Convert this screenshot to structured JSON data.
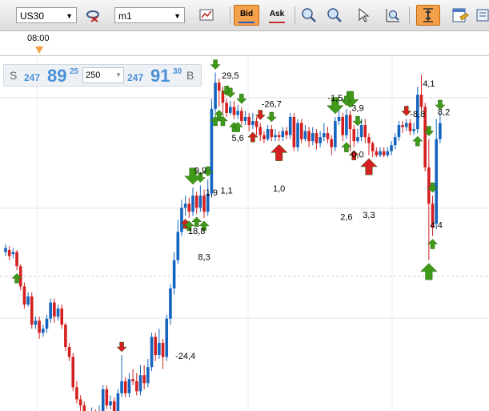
{
  "toolbar": {
    "symbol": "US30",
    "timeframe": "m1",
    "bid_label": "Bid",
    "ask_label": "Ask"
  },
  "time_axis": {
    "label": "08:00"
  },
  "quote": {
    "sell_label": "S",
    "sell_prefix": "247",
    "sell_main": "89",
    "sell_sup": "25",
    "amount": "250",
    "buy_prefix": "247",
    "buy_main": "91",
    "buy_sup": "30",
    "buy_label": "B"
  },
  "colors": {
    "bull": "#1565c0",
    "bear": "#d42020",
    "arrow_green": "#3f9a1a",
    "arrow_red": "#d42020",
    "accent": "#f5a04a"
  },
  "chart_data": {
    "type": "candlestick",
    "candles": [
      {
        "o": 356,
        "c": 358,
        "h": 360,
        "l": 354
      },
      {
        "o": 357,
        "c": 354,
        "h": 359,
        "l": 352
      },
      {
        "o": 355,
        "c": 356,
        "h": 358,
        "l": 353
      },
      {
        "o": 356,
        "c": 349,
        "h": 357,
        "l": 347
      },
      {
        "o": 349,
        "c": 339,
        "h": 350,
        "l": 337
      },
      {
        "o": 339,
        "c": 330,
        "h": 341,
        "l": 328
      },
      {
        "o": 330,
        "c": 334,
        "h": 336,
        "l": 329
      },
      {
        "o": 334,
        "c": 320,
        "h": 336,
        "l": 318
      },
      {
        "o": 320,
        "c": 322,
        "h": 324,
        "l": 318
      },
      {
        "o": 322,
        "c": 316,
        "h": 324,
        "l": 313
      },
      {
        "o": 316,
        "c": 318,
        "h": 320,
        "l": 314
      },
      {
        "o": 318,
        "c": 323,
        "h": 325,
        "l": 316
      },
      {
        "o": 323,
        "c": 331,
        "h": 333,
        "l": 321
      },
      {
        "o": 331,
        "c": 324,
        "h": 333,
        "l": 321
      },
      {
        "o": 324,
        "c": 328,
        "h": 330,
        "l": 322
      },
      {
        "o": 328,
        "c": 320,
        "h": 330,
        "l": 318
      },
      {
        "o": 320,
        "c": 309,
        "h": 321,
        "l": 307
      },
      {
        "o": 309,
        "c": 304,
        "h": 311,
        "l": 302
      },
      {
        "o": 304,
        "c": 289,
        "h": 306,
        "l": 287
      },
      {
        "o": 289,
        "c": 283,
        "h": 292,
        "l": 281
      },
      {
        "o": 283,
        "c": 280,
        "h": 285,
        "l": 276
      },
      {
        "o": 280,
        "c": 274,
        "h": 282,
        "l": 272
      },
      {
        "o": 274,
        "c": 270,
        "h": 276,
        "l": 268
      },
      {
        "o": 270,
        "c": 276,
        "h": 279,
        "l": 268
      },
      {
        "o": 276,
        "c": 271,
        "h": 278,
        "l": 268
      },
      {
        "o": 271,
        "c": 276,
        "h": 280,
        "l": 269
      },
      {
        "o": 276,
        "c": 288,
        "h": 290,
        "l": 274
      },
      {
        "o": 288,
        "c": 280,
        "h": 290,
        "l": 278
      },
      {
        "o": 280,
        "c": 282,
        "h": 285,
        "l": 278
      },
      {
        "o": 282,
        "c": 273,
        "h": 284,
        "l": 271
      },
      {
        "o": 273,
        "c": 286,
        "h": 288,
        "l": 271
      },
      {
        "o": 286,
        "c": 292,
        "h": 305,
        "l": 284
      },
      {
        "o": 292,
        "c": 286,
        "h": 294,
        "l": 284
      },
      {
        "o": 286,
        "c": 293,
        "h": 296,
        "l": 284
      },
      {
        "o": 293,
        "c": 292,
        "h": 298,
        "l": 290
      },
      {
        "o": 292,
        "c": 287,
        "h": 296,
        "l": 285
      },
      {
        "o": 287,
        "c": 295,
        "h": 300,
        "l": 285
      },
      {
        "o": 295,
        "c": 291,
        "h": 300,
        "l": 288
      },
      {
        "o": 291,
        "c": 299,
        "h": 303,
        "l": 289
      },
      {
        "o": 299,
        "c": 314,
        "h": 316,
        "l": 297
      },
      {
        "o": 314,
        "c": 305,
        "h": 316,
        "l": 302
      },
      {
        "o": 305,
        "c": 311,
        "h": 318,
        "l": 303
      },
      {
        "o": 311,
        "c": 304,
        "h": 313,
        "l": 298
      },
      {
        "o": 304,
        "c": 323,
        "h": 325,
        "l": 302
      },
      {
        "o": 323,
        "c": 338,
        "h": 340,
        "l": 320
      },
      {
        "o": 338,
        "c": 352,
        "h": 356,
        "l": 335
      },
      {
        "o": 352,
        "c": 366,
        "h": 372,
        "l": 350
      },
      {
        "o": 366,
        "c": 378,
        "h": 382,
        "l": 364
      },
      {
        "o": 378,
        "c": 380,
        "h": 384,
        "l": 374
      },
      {
        "o": 380,
        "c": 376,
        "h": 383,
        "l": 373
      },
      {
        "o": 376,
        "c": 384,
        "h": 388,
        "l": 374
      },
      {
        "o": 384,
        "c": 378,
        "h": 386,
        "l": 375
      },
      {
        "o": 378,
        "c": 384,
        "h": 389,
        "l": 376
      },
      {
        "o": 384,
        "c": 376,
        "h": 387,
        "l": 373
      },
      {
        "o": 376,
        "c": 385,
        "h": 392,
        "l": 374
      },
      {
        "o": 385,
        "c": 427,
        "h": 432,
        "l": 383
      },
      {
        "o": 427,
        "c": 440,
        "h": 445,
        "l": 425
      },
      {
        "o": 440,
        "c": 436,
        "h": 442,
        "l": 428
      },
      {
        "o": 436,
        "c": 430,
        "h": 438,
        "l": 425
      },
      {
        "o": 430,
        "c": 425,
        "h": 432,
        "l": 423
      },
      {
        "o": 425,
        "c": 428,
        "h": 431,
        "l": 424
      },
      {
        "o": 428,
        "c": 424,
        "h": 431,
        "l": 422
      },
      {
        "o": 424,
        "c": 426,
        "h": 429,
        "l": 422
      },
      {
        "o": 426,
        "c": 421,
        "h": 428,
        "l": 419
      },
      {
        "o": 421,
        "c": 423,
        "h": 426,
        "l": 419
      },
      {
        "o": 423,
        "c": 419,
        "h": 425,
        "l": 416
      },
      {
        "o": 419,
        "c": 421,
        "h": 425,
        "l": 417
      },
      {
        "o": 421,
        "c": 418,
        "h": 423,
        "l": 414
      },
      {
        "o": 418,
        "c": 414,
        "h": 420,
        "l": 411
      },
      {
        "o": 414,
        "c": 412,
        "h": 416,
        "l": 410
      },
      {
        "o": 412,
        "c": 417,
        "h": 419,
        "l": 411
      },
      {
        "o": 417,
        "c": 413,
        "h": 419,
        "l": 411
      },
      {
        "o": 413,
        "c": 414,
        "h": 417,
        "l": 411
      },
      {
        "o": 414,
        "c": 413,
        "h": 416,
        "l": 411
      },
      {
        "o": 413,
        "c": 416,
        "h": 418,
        "l": 411
      },
      {
        "o": 416,
        "c": 414,
        "h": 418,
        "l": 412
      },
      {
        "o": 414,
        "c": 423,
        "h": 425,
        "l": 412
      },
      {
        "o": 423,
        "c": 408,
        "h": 425,
        "l": 406
      },
      {
        "o": 408,
        "c": 420,
        "h": 422,
        "l": 406
      },
      {
        "o": 420,
        "c": 412,
        "h": 422,
        "l": 410
      },
      {
        "o": 412,
        "c": 416,
        "h": 419,
        "l": 411
      },
      {
        "o": 416,
        "c": 411,
        "h": 418,
        "l": 408
      },
      {
        "o": 411,
        "c": 415,
        "h": 418,
        "l": 409
      },
      {
        "o": 415,
        "c": 410,
        "h": 417,
        "l": 407
      },
      {
        "o": 410,
        "c": 413,
        "h": 416,
        "l": 408
      },
      {
        "o": 413,
        "c": 415,
        "h": 420,
        "l": 411
      },
      {
        "o": 415,
        "c": 412,
        "h": 418,
        "l": 410
      },
      {
        "o": 412,
        "c": 408,
        "h": 414,
        "l": 404
      },
      {
        "o": 408,
        "c": 421,
        "h": 423,
        "l": 406
      },
      {
        "o": 421,
        "c": 423,
        "h": 427,
        "l": 419
      },
      {
        "o": 423,
        "c": 414,
        "h": 425,
        "l": 411
      },
      {
        "o": 414,
        "c": 424,
        "h": 427,
        "l": 412
      },
      {
        "o": 424,
        "c": 417,
        "h": 426,
        "l": 406
      },
      {
        "o": 417,
        "c": 411,
        "h": 419,
        "l": 408
      },
      {
        "o": 411,
        "c": 413,
        "h": 417,
        "l": 410
      },
      {
        "o": 413,
        "c": 419,
        "h": 422,
        "l": 411
      },
      {
        "o": 419,
        "c": 413,
        "h": 422,
        "l": 410
      },
      {
        "o": 413,
        "c": 410,
        "h": 415,
        "l": 404
      },
      {
        "o": 410,
        "c": 406,
        "h": 411,
        "l": 403
      },
      {
        "o": 406,
        "c": 404,
        "h": 408,
        "l": 403
      },
      {
        "o": 404,
        "c": 406,
        "h": 408,
        "l": 403
      },
      {
        "o": 406,
        "c": 404,
        "h": 408,
        "l": 403
      },
      {
        "o": 404,
        "c": 406,
        "h": 408,
        "l": 403
      },
      {
        "o": 406,
        "c": 409,
        "h": 411,
        "l": 404
      },
      {
        "o": 409,
        "c": 413,
        "h": 415,
        "l": 407
      },
      {
        "o": 413,
        "c": 419,
        "h": 421,
        "l": 411
      },
      {
        "o": 419,
        "c": 418,
        "h": 421,
        "l": 415
      },
      {
        "o": 418,
        "c": 420,
        "h": 422,
        "l": 416
      },
      {
        "o": 420,
        "c": 416,
        "h": 422,
        "l": 414
      },
      {
        "o": 416,
        "c": 417,
        "h": 420,
        "l": 414
      },
      {
        "o": 417,
        "c": 434,
        "h": 438,
        "l": 415
      },
      {
        "o": 434,
        "c": 428,
        "h": 444,
        "l": 426
      },
      {
        "o": 428,
        "c": 398,
        "h": 430,
        "l": 396
      },
      {
        "o": 398,
        "c": 380,
        "h": 412,
        "l": 352
      },
      {
        "o": 380,
        "c": 368,
        "h": 384,
        "l": 364
      },
      {
        "o": 370,
        "c": 412,
        "h": 422,
        "l": 368
      },
      {
        "o": 412,
        "c": 420,
        "h": 425,
        "l": 410
      }
    ],
    "arrows": [
      {
        "i": 3,
        "dir": "up",
        "big": false,
        "color": "green"
      },
      {
        "i": 31,
        "dir": "down",
        "big": false,
        "color": "red"
      },
      {
        "i": 48,
        "dir": "up",
        "big": false,
        "color": "red"
      },
      {
        "i": 49,
        "dir": "up",
        "big": false,
        "color": "green"
      },
      {
        "i": 51,
        "dir": "up",
        "big": false,
        "color": "green"
      },
      {
        "i": 49,
        "dir": "up",
        "big": false,
        "color": "green"
      },
      {
        "i": 52,
        "dir": "down",
        "big": false,
        "color": "green"
      },
      {
        "i": 53,
        "dir": "up",
        "big": false,
        "color": "green"
      },
      {
        "i": 50,
        "dir": "down",
        "big": true,
        "color": "green"
      },
      {
        "i": 54,
        "dir": "down",
        "big": false,
        "color": "green"
      },
      {
        "i": 56,
        "dir": "down",
        "big": false,
        "color": "green"
      },
      {
        "i": 56,
        "dir": "up",
        "big": false,
        "color": "green"
      },
      {
        "i": 57,
        "dir": "up",
        "big": false,
        "color": "green"
      },
      {
        "i": 58,
        "dir": "up",
        "big": false,
        "color": "green"
      },
      {
        "i": 59,
        "dir": "down",
        "big": false,
        "color": "green"
      },
      {
        "i": 60,
        "dir": "down",
        "big": false,
        "color": "green"
      },
      {
        "i": 61,
        "dir": "up",
        "big": false,
        "color": "green"
      },
      {
        "i": 62,
        "dir": "up",
        "big": false,
        "color": "green"
      },
      {
        "i": 63,
        "dir": "down",
        "big": false,
        "color": "green"
      },
      {
        "i": 66,
        "dir": "up",
        "big": false,
        "color": "green"
      },
      {
        "i": 68,
        "dir": "down",
        "big": false,
        "color": "red"
      },
      {
        "i": 66,
        "dir": "up",
        "big": false,
        "color": "red"
      },
      {
        "i": 71,
        "dir": "down",
        "big": false,
        "color": "green"
      },
      {
        "i": 73,
        "dir": "up",
        "big": true,
        "color": "red"
      },
      {
        "i": 88,
        "dir": "down",
        "big": true,
        "color": "green"
      },
      {
        "i": 93,
        "dir": "up",
        "big": false,
        "color": "green"
      },
      {
        "i": 92,
        "dir": "down",
        "big": true,
        "color": "green"
      },
      {
        "i": 91,
        "dir": "down",
        "big": false,
        "color": "green"
      },
      {
        "i": 91,
        "dir": "up",
        "big": false,
        "color": "green"
      },
      {
        "i": 94,
        "dir": "down",
        "big": false,
        "color": "green"
      },
      {
        "i": 97,
        "dir": "up",
        "big": true,
        "color": "red"
      },
      {
        "i": 93,
        "dir": "up",
        "big": false,
        "color": "red"
      },
      {
        "i": 107,
        "dir": "down",
        "big": false,
        "color": "red"
      },
      {
        "i": 110,
        "dir": "up",
        "big": false,
        "color": "green"
      },
      {
        "i": 114,
        "dir": "down",
        "big": false,
        "color": "green"
      },
      {
        "i": 113,
        "dir": "down",
        "big": false,
        "color": "green"
      },
      {
        "i": 114,
        "dir": "up",
        "big": false,
        "color": "green"
      },
      {
        "i": 113,
        "dir": "up",
        "big": true,
        "color": "green"
      },
      {
        "i": 116,
        "dir": "down",
        "big": false,
        "color": "green"
      }
    ],
    "annotations": [
      {
        "text": "-24,4",
        "i": 48,
        "v": 303
      },
      {
        "text": "18,8",
        "i": 51,
        "v": 365
      },
      {
        "text": "8,3",
        "i": 53,
        "v": 352
      },
      {
        "text": "9,9",
        "i": 52,
        "v": 395
      },
      {
        "text": "1,9",
        "i": 55,
        "v": 384
      },
      {
        "text": "1,1",
        "i": 59,
        "v": 385
      },
      {
        "text": "29,5",
        "i": 60,
        "v": 442
      },
      {
        "text": "5,6",
        "i": 62,
        "v": 411
      },
      {
        "text": "-26,7",
        "i": 71,
        "v": 428
      },
      {
        "text": "1,0",
        "i": 73,
        "v": 386
      },
      {
        "text": "-1,5",
        "i": 88,
        "v": 431
      },
      {
        "text": "3,9",
        "i": 94,
        "v": 426
      },
      {
        "text": "0,0",
        "i": 94,
        "v": 403
      },
      {
        "text": "2,6",
        "i": 91,
        "v": 372
      },
      {
        "text": "3,3",
        "i": 97,
        "v": 373
      },
      {
        "text": "-8,8",
        "i": 110,
        "v": 423
      },
      {
        "text": "4,1",
        "i": 113,
        "v": 438
      },
      {
        "text": "8,2",
        "i": 117,
        "v": 424
      },
      {
        "text": "4,4",
        "i": 115,
        "v": 368
      }
    ],
    "ylim": [
      280,
      450
    ],
    "grid": true
  }
}
